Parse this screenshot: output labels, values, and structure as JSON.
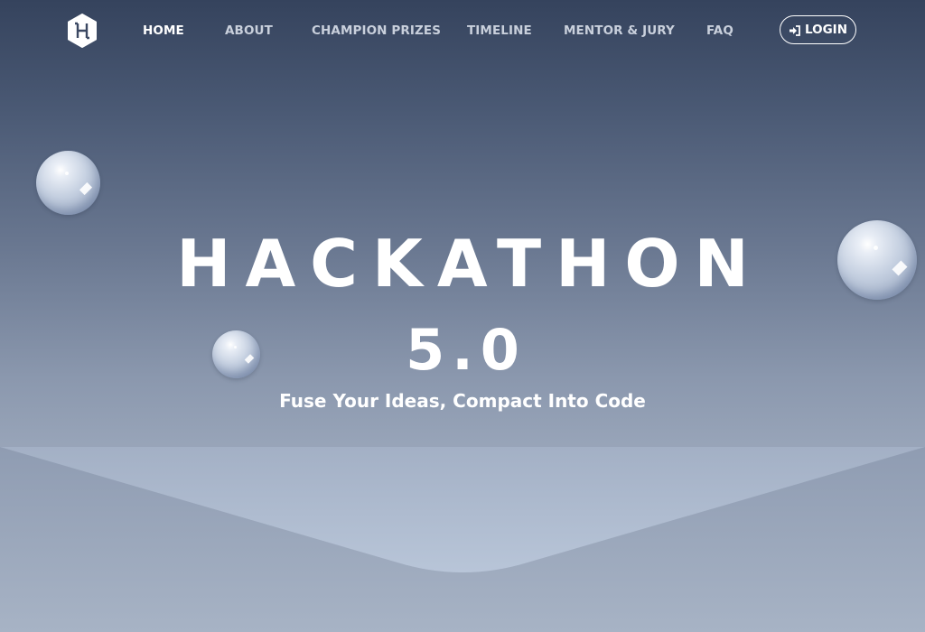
{
  "brand": {
    "logo_letter": "H",
    "logo_icon": "hexagon-logo-icon"
  },
  "nav": {
    "items": [
      {
        "label": "HOME",
        "active": true
      },
      {
        "label": "ABOUT",
        "active": false
      },
      {
        "label": "CHAMPION PRIZES",
        "active": false
      },
      {
        "label": "TIMELINE",
        "active": false
      },
      {
        "label": "MENTOR & JURY",
        "active": false
      },
      {
        "label": "FAQ",
        "active": false
      }
    ],
    "login": {
      "label": "LOGIN",
      "icon": "sign-in-icon"
    }
  },
  "hero": {
    "title": "HACKATHON",
    "version": "5.0",
    "tagline": "Fuse Your Ideas, Compact Into Code"
  },
  "colors": {
    "background_top": "#35435d",
    "background_bottom": "#aab6c8",
    "chevron_light": "#b6c3d6",
    "text": "#ffffff",
    "nav_inactive": "#c9d0dc"
  }
}
